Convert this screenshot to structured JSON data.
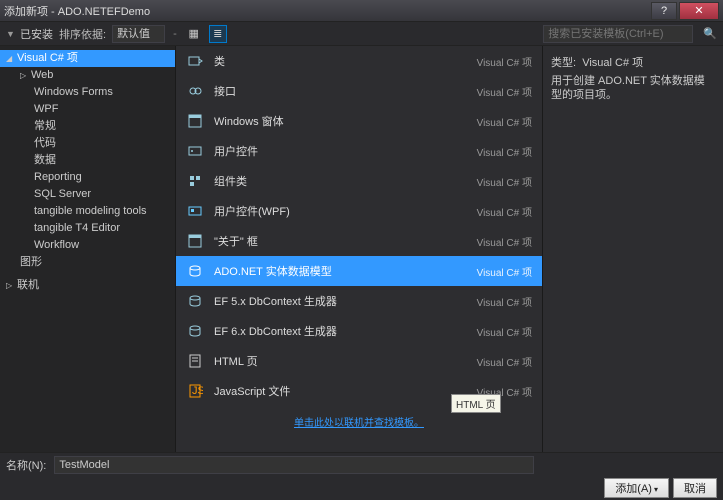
{
  "titlebar": {
    "title": "添加新项 - ADO.NETEFDemo"
  },
  "toolbar": {
    "installed": "已安装",
    "sort_label": "排序依据:",
    "sort_value": "默认值",
    "search_placeholder": "搜索已安装模板(Ctrl+E)"
  },
  "tree": {
    "root": "Visual C# 项",
    "children": [
      {
        "label": "Web",
        "expandable": true
      },
      {
        "label": "Windows Forms"
      },
      {
        "label": "WPF"
      },
      {
        "label": "常规"
      },
      {
        "label": "代码"
      },
      {
        "label": "数据"
      },
      {
        "label": "Reporting"
      },
      {
        "label": "SQL Server"
      },
      {
        "label": "tangible modeling tools"
      },
      {
        "label": "tangible T4 Editor"
      },
      {
        "label": "Workflow"
      }
    ],
    "sibling1": "图形",
    "top2": "联机"
  },
  "items": [
    {
      "label": "类",
      "cat": "Visual C# 项"
    },
    {
      "label": "接口",
      "cat": "Visual C# 项"
    },
    {
      "label": "Windows 窗体",
      "cat": "Visual C# 项"
    },
    {
      "label": "用户控件",
      "cat": "Visual C# 项"
    },
    {
      "label": "组件类",
      "cat": "Visual C# 项"
    },
    {
      "label": "用户控件(WPF)",
      "cat": "Visual C# 项"
    },
    {
      "label": "\"关于\" 框",
      "cat": "Visual C# 项"
    },
    {
      "label": "ADO.NET 实体数据模型",
      "cat": "Visual C# 项",
      "selected": true
    },
    {
      "label": "EF 5.x DbContext 生成器",
      "cat": "Visual C# 项"
    },
    {
      "label": "EF 6.x DbContext 生成器",
      "cat": "Visual C# 项"
    },
    {
      "label": "HTML 页",
      "cat": "Visual C# 项"
    },
    {
      "label": "JavaScript 文件",
      "cat": "Visual C# 项"
    }
  ],
  "tooltip": "HTML 页",
  "online_link": "单击此处以联机并查找模板。",
  "desc": {
    "type_label": "类型:",
    "type_value": "Visual C# 项",
    "body": "用于创建 ADO.NET 实体数据模型的项目项。"
  },
  "name": {
    "label": "名称(N):",
    "value": "TestModel"
  },
  "buttons": {
    "add": "添加(A)",
    "cancel": "取消"
  }
}
